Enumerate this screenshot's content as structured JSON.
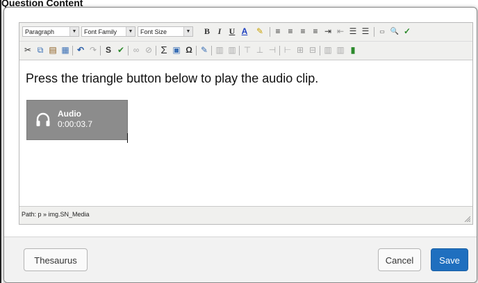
{
  "page": {
    "background_title": "Question Content"
  },
  "toolbar": {
    "row1": [
      {
        "id": "paragraph",
        "kind": "select",
        "value": "Paragraph"
      },
      {
        "id": "font_family",
        "kind": "select",
        "value": "Font Family"
      },
      {
        "id": "font_size",
        "kind": "select",
        "value": "Font Size"
      },
      {
        "id": "bold",
        "glyph": "B",
        "icon": "bold-icon"
      },
      {
        "id": "italic",
        "glyph": "I",
        "icon": "italic-icon"
      },
      {
        "id": "underline",
        "glyph": "U",
        "icon": "underline-icon"
      },
      {
        "id": "text_color",
        "glyph": "A",
        "icon": "text-color-icon"
      },
      {
        "id": "highlight",
        "glyph": "✎",
        "icon": "highlight-color-icon"
      },
      {
        "id": "align_left",
        "glyph": "≡",
        "icon": "align-left-icon"
      },
      {
        "id": "align_center",
        "glyph": "≡",
        "icon": "align-center-icon"
      },
      {
        "id": "align_right",
        "glyph": "≡",
        "icon": "align-right-icon"
      },
      {
        "id": "align_justify",
        "glyph": "≡",
        "icon": "align-justify-icon"
      },
      {
        "id": "indent",
        "glyph": "⇥",
        "icon": "indent-icon"
      },
      {
        "id": "outdent",
        "glyph": "⇤",
        "icon": "outdent-icon"
      },
      {
        "id": "ordered_list",
        "glyph": "☰",
        "icon": "ordered-list-icon"
      },
      {
        "id": "bullet_list",
        "glyph": "☰",
        "icon": "bullet-list-icon"
      },
      {
        "id": "html",
        "glyph": "▭",
        "icon": "html-source-icon"
      },
      {
        "id": "find",
        "glyph": "🔍",
        "icon": "find-replace-icon"
      },
      {
        "id": "spell_check",
        "glyph": "✓",
        "icon": "spell-check-icon"
      }
    ],
    "row2": [
      {
        "id": "cut",
        "glyph": "✂",
        "icon": "cut-icon"
      },
      {
        "id": "copy",
        "glyph": "⧉",
        "icon": "copy-icon"
      },
      {
        "id": "paste",
        "glyph": "▤",
        "icon": "paste-icon"
      },
      {
        "id": "paste_word",
        "glyph": "▦",
        "icon": "paste-word-icon"
      },
      {
        "id": "undo",
        "glyph": "↶",
        "icon": "undo-icon"
      },
      {
        "id": "redo",
        "glyph": "↷",
        "icon": "redo-icon"
      },
      {
        "id": "spellchecker",
        "glyph": "S",
        "icon": "spellchecker-icon"
      },
      {
        "id": "cleanup",
        "glyph": "✔",
        "icon": "cleanup-icon"
      },
      {
        "id": "link",
        "glyph": "∞",
        "icon": "link-icon"
      },
      {
        "id": "unlink",
        "glyph": "⊘",
        "icon": "unlink-icon"
      },
      {
        "id": "sum",
        "glyph": "Σ",
        "icon": "equation-icon"
      },
      {
        "id": "image",
        "glyph": "▣",
        "icon": "image-icon"
      },
      {
        "id": "omega",
        "glyph": "Ω",
        "icon": "special-char-icon"
      },
      {
        "id": "edit",
        "glyph": "✎",
        "icon": "edit-icon"
      },
      {
        "id": "table1",
        "glyph": "▥",
        "icon": "table-icon"
      },
      {
        "id": "table2",
        "glyph": "▥",
        "icon": "table-props-icon"
      },
      {
        "id": "row_before",
        "glyph": "⊤",
        "icon": "insert-row-icon"
      },
      {
        "id": "row_after",
        "glyph": "⊥",
        "icon": "insert-row-after-icon"
      },
      {
        "id": "col_before",
        "glyph": "⊣",
        "icon": "insert-col-icon"
      },
      {
        "id": "col_after",
        "glyph": "⊢",
        "icon": "insert-col-after-icon"
      },
      {
        "id": "merge",
        "glyph": "⊞",
        "icon": "merge-cells-icon"
      },
      {
        "id": "split",
        "glyph": "⊟",
        "icon": "split-cells-icon"
      },
      {
        "id": "film",
        "glyph": "▮",
        "icon": "media-icon"
      }
    ]
  },
  "content": {
    "text": "Press the triangle button below to play the audio clip.",
    "audio": {
      "title": "Audio",
      "time": "0:00:03.7",
      "icon": "headphones-icon"
    }
  },
  "status": {
    "path": "Path: p » img.SN_Media"
  },
  "footer": {
    "thesaurus": "Thesaurus",
    "cancel": "Cancel",
    "save": "Save"
  },
  "colors": {
    "save_button": "#1f6fbf",
    "audio_bg": "#8c8c8c",
    "toolbar_bg": "#f0f0ee"
  }
}
